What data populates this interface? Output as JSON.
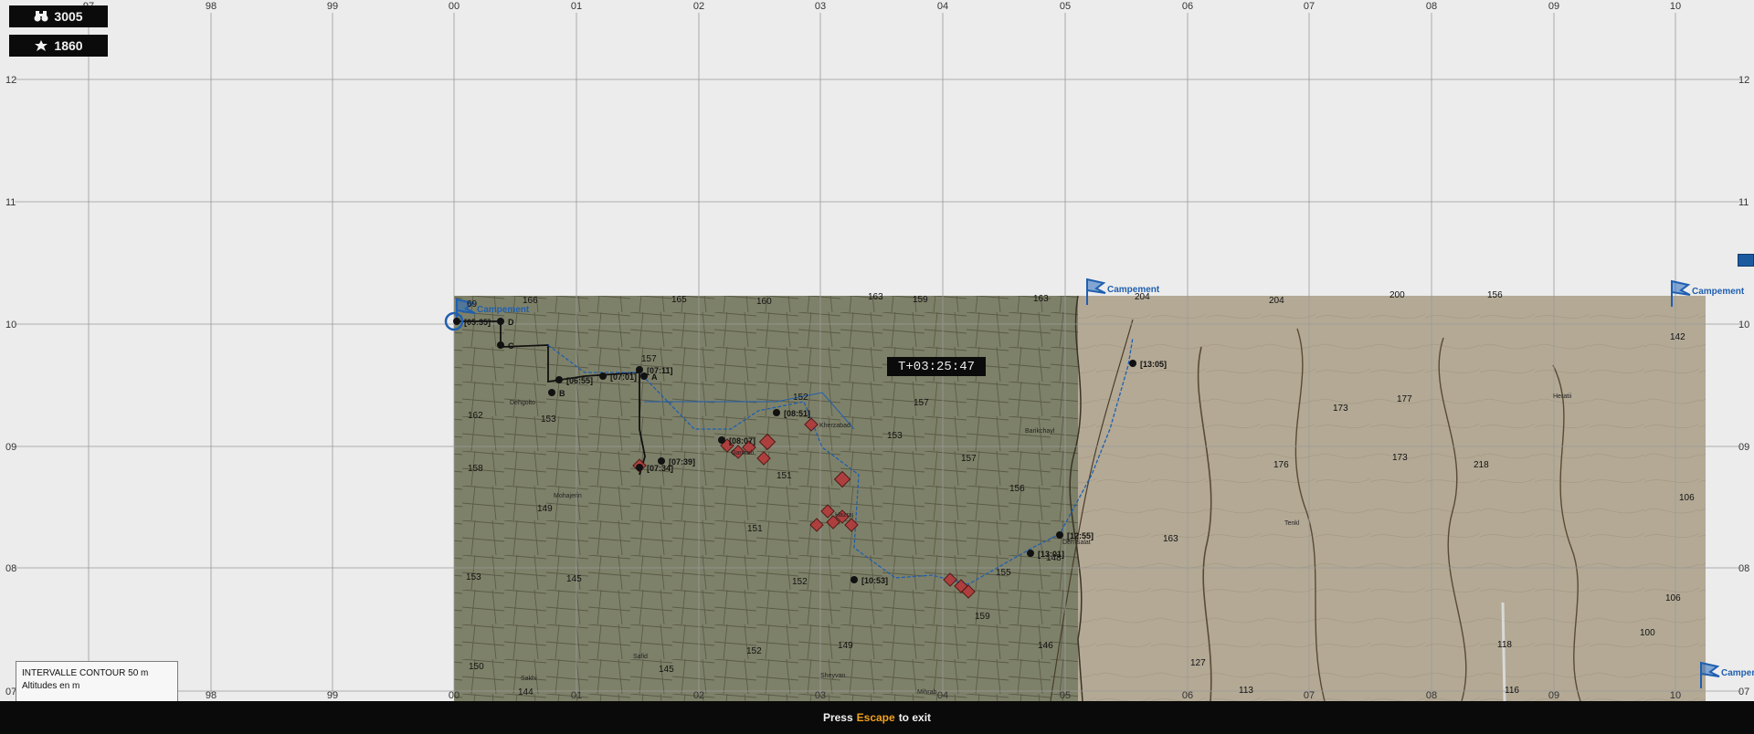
{
  "counters": [
    {
      "icon": "binoculars-icon",
      "value": "3005"
    },
    {
      "icon": "soldier-icon",
      "value": "1860"
    }
  ],
  "grid": {
    "x_labels": [
      "97",
      "98",
      "99",
      "00",
      "01",
      "02",
      "03",
      "04",
      "05",
      "06",
      "07",
      "08",
      "09",
      "10"
    ],
    "y_labels": [
      "12",
      "11",
      "10",
      "09",
      "08",
      "07"
    ]
  },
  "timer": "T+03:25:47",
  "legend": {
    "line1": "INTERVALLE CONTOUR 50 m",
    "line2": "Altitudes en m"
  },
  "exit": {
    "prefix": "Press",
    "key": "Escape",
    "suffix": "to exit"
  },
  "campements": [
    {
      "label": "Campement"
    },
    {
      "label": "Campement"
    },
    {
      "label": "Campement"
    },
    {
      "label": "Campement"
    }
  ],
  "waypoints": [
    {
      "label": "D"
    },
    {
      "label": "C"
    },
    {
      "label": "B"
    },
    {
      "label": "A"
    },
    {
      "label": "[05:35]"
    },
    {
      "label": "[06:55]"
    },
    {
      "label": "[07:01]"
    },
    {
      "label": "[07:11]"
    },
    {
      "label": "[07:34]"
    },
    {
      "label": "[07:39]"
    },
    {
      "label": "[08:07]"
    },
    {
      "label": "[08:51]"
    },
    {
      "label": "[10:53]"
    },
    {
      "label": "[13:01]"
    },
    {
      "label": "[12:55]"
    },
    {
      "label": "[13:05]"
    }
  ],
  "elevations": [
    "69",
    "166",
    "165",
    "160",
    "163",
    "159",
    "163",
    "204",
    "204",
    "200",
    "156",
    "142",
    "162",
    "153",
    "158",
    "157",
    "152",
    "157",
    "153",
    "149",
    "151",
    "156",
    "157",
    "177",
    "173",
    "173",
    "218",
    "176",
    "153",
    "145",
    "152",
    "151",
    "155",
    "148",
    "163",
    "106",
    "106",
    "100",
    "150",
    "144",
    "145",
    "152",
    "149",
    "159",
    "146",
    "127",
    "113",
    "118",
    "116"
  ],
  "places": [
    "Dehgolto",
    "Mohajerin",
    "Qarmeh",
    "Barikchayl",
    "Heratii",
    "Tenkl",
    "Deh Salat",
    "Hazraj",
    "Kherzabad",
    "Safid",
    "Sheyvan",
    "Mihrab",
    "Sakhi"
  ],
  "colors": {
    "cultivated": "#7e8169",
    "desert": "#b3a995",
    "friendly": "#1f5fb0",
    "enemy": "#b33a3a",
    "route": "#111111"
  }
}
